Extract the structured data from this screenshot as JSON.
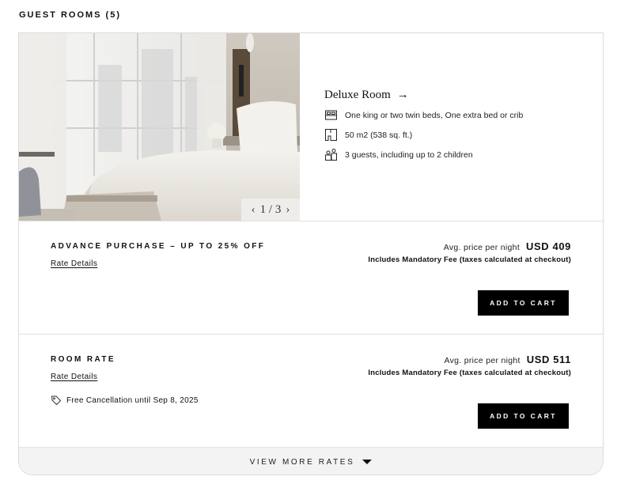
{
  "section": {
    "title": "GUEST ROOMS (5)"
  },
  "room": {
    "name": "Deluxe Room",
    "arrow": "→",
    "photo_counter": "1 / 3",
    "prev": "‹",
    "next": "›",
    "features": [
      {
        "icon": "bed-icon",
        "text": "One king or two twin beds, One extra bed or crib"
      },
      {
        "icon": "floorplan-icon",
        "text": "50 m2 (538 sq. ft.)"
      },
      {
        "icon": "guests-icon",
        "text": "3 guests, including up to 2 children"
      }
    ]
  },
  "rates": [
    {
      "name": "ADVANCE PURCHASE – UP TO 25% OFF",
      "details_link": "Rate Details",
      "price_label": "Avg. price per night",
      "price": "USD 409",
      "fee_note": "Includes Mandatory Fee (taxes calculated at checkout)",
      "button": "ADD TO CART"
    },
    {
      "name": "ROOM RATE",
      "details_link": "Rate Details",
      "cancellation": "Free Cancellation until Sep 8, 2025",
      "price_label": "Avg. price per night",
      "price": "USD 511",
      "fee_note": "Includes Mandatory Fee (taxes calculated at checkout)",
      "button": "ADD TO CART"
    }
  ],
  "footer": {
    "view_more": "VIEW MORE RATES"
  },
  "colors": {
    "button_bg": "#000000",
    "border": "#dcdcdc",
    "footer_bg": "#f3f3f3"
  }
}
